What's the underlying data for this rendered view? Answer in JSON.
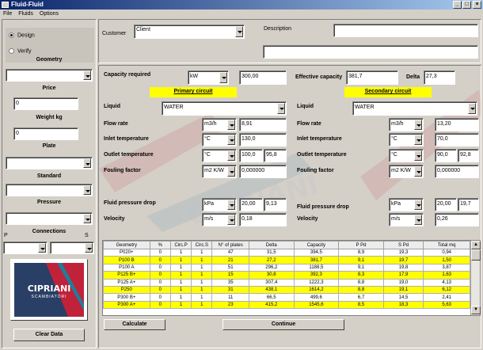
{
  "window": {
    "title": "Fluid-Fluid"
  },
  "menu": [
    "File",
    "Fluids",
    "Options"
  ],
  "left": {
    "mode_options": [
      "Design",
      "Verify"
    ],
    "mode_selected": "Design",
    "geometry_label": "Geometry",
    "geometry_value": "",
    "price_label": "Price",
    "price_value": "0",
    "weight_label": "Weight kg",
    "weight_value": "0",
    "plate_label": "Plate",
    "plate_value": "",
    "standard_label": "Standard",
    "standard_value": "",
    "pressure_label": "Pressure",
    "pressure_value": "",
    "connections_label": "Connections",
    "conn_p_label": "P",
    "conn_s_label": "S",
    "logo_brand": "CIPRIANI",
    "logo_sub": "SCAMBIATORI",
    "clear_button": "Clear Data"
  },
  "header": {
    "customer_label": "Customer",
    "customer_value": "Client",
    "description_label": "Description",
    "description_value": "",
    "description2_value": ""
  },
  "capacity": {
    "label": "Capacity required",
    "unit": "kW",
    "value": "300,00",
    "effective_label": "Effective capacity",
    "effective_value": "381,7",
    "delta_label": "Delta",
    "delta_value": "27,3"
  },
  "primary": {
    "title": "Primary circuit",
    "liquid_label": "Liquid",
    "liquid_value": "WATER",
    "flow_label": "Flow rate",
    "flow_unit": "m3/h",
    "flow_value": "8,91",
    "inlet_label": "Inlet temperature",
    "inlet_unit": "°C",
    "inlet_value": "130,0",
    "outlet_label": "Outlet temperature",
    "outlet_unit": "°C",
    "outlet_value": "100,0",
    "outlet_value2": "95,8",
    "fouling_label": "Fouling factor",
    "fouling_unit": "m2 K/W",
    "fouling_value": "0,000000",
    "pdrop_label": "Fluid pressure drop",
    "pdrop_unit": "kPa",
    "pdrop_value": "20,00",
    "pdrop_value2": "9,13",
    "velocity_label": "Velocity",
    "velocity_unit": "m/s",
    "velocity_value": "0,18"
  },
  "secondary": {
    "title": "Secondary circuit",
    "liquid_label": "Liquid",
    "liquid_value": "WATER",
    "flow_label": "Flow rate",
    "flow_unit": "m3/h",
    "flow_value": "13,20",
    "inlet_label": "Inlet temperature",
    "inlet_unit": "°C",
    "inlet_value": "70,0",
    "outlet_label": "Outlet temperature",
    "outlet_unit": "°C",
    "outlet_value": "90,0",
    "outlet_value2": "92,8",
    "fouling_label": "Fouling factor",
    "fouling_unit": "m2 K/W",
    "fouling_value": "0,000000",
    "pdrop_label": "Fluid pressure drop",
    "pdrop_unit": "kPa",
    "pdrop_value": "20,00",
    "pdrop_value2": "19,7",
    "velocity_label": "Velocity",
    "velocity_unit": "m/s",
    "velocity_value": "0,26"
  },
  "table": {
    "columns": [
      "Geometry",
      "%",
      "Circ.P",
      "Circ.S",
      "N° of plates",
      "Delta",
      "Capacity",
      "P Pd",
      "S Pd",
      "Total mq"
    ],
    "rows": [
      {
        "cells": [
          "P020+",
          "0",
          "1",
          "1",
          "47",
          "31,5",
          "394,5",
          "8,9",
          "19,3",
          "0,94"
        ],
        "hl": false
      },
      {
        "cells": [
          "P100 B",
          "0",
          "1",
          "1",
          "21",
          "27,2",
          "381,7",
          "9,1",
          "19,7",
          "1,50"
        ],
        "hl": true
      },
      {
        "cells": [
          "P100 A",
          "0",
          "1",
          "1",
          "51",
          "296,2",
          "1188,5",
          "9,1",
          "19,8",
          "3,87"
        ],
        "hl": false
      },
      {
        "cells": [
          "P125 B+",
          "0",
          "1",
          "1",
          "15",
          "30,8",
          "392,3",
          "8,3",
          "17,9",
          "1,63"
        ],
        "hl": true
      },
      {
        "cells": [
          "P125 A+",
          "0",
          "1",
          "1",
          "35",
          "307,4",
          "1222,3",
          "8,8",
          "19,0",
          "4,13"
        ],
        "hl": false
      },
      {
        "cells": [
          "P250",
          "0",
          "1",
          "1",
          "31",
          "438,1",
          "1614,2",
          "8,8",
          "19,1",
          "6,12"
        ],
        "hl": true
      },
      {
        "cells": [
          "P300 B+",
          "0",
          "1",
          "1",
          "11",
          "66,5",
          "499,6",
          "6,7",
          "14,5",
          "2,41"
        ],
        "hl": false
      },
      {
        "cells": [
          "P300 A+",
          "0",
          "1",
          "1",
          "23",
          "415,2",
          "1545,6",
          "8,5",
          "18,3",
          "5,63"
        ],
        "hl": true
      }
    ]
  },
  "buttons": {
    "calculate": "Calculate",
    "continue": "Continue"
  },
  "watermark": "CIPRIANI"
}
